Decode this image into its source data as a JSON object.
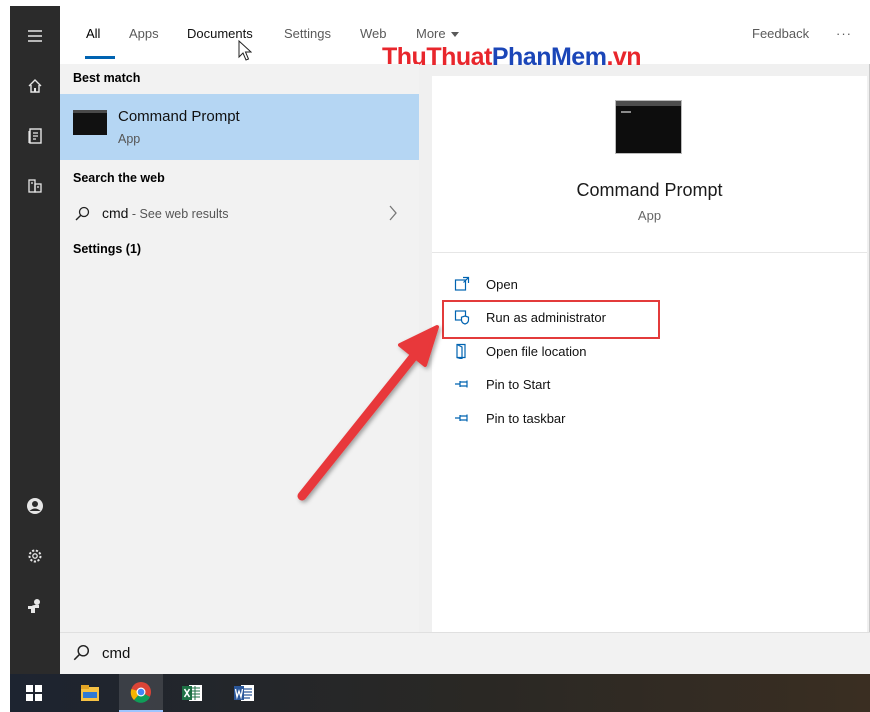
{
  "tabs": {
    "items": [
      "All",
      "Apps",
      "Documents",
      "Settings",
      "Web",
      "More"
    ],
    "feedback": "Feedback",
    "overflow": "···"
  },
  "watermark": {
    "part1": "ThuThuat",
    "part2": "PhanMem",
    "part3": ".vn"
  },
  "results": {
    "best_match_heading": "Best match",
    "best_match": {
      "title": "Command Prompt",
      "subtitle": "App"
    },
    "web_heading": "Search the web",
    "web_query": "cmd",
    "web_hint": " - See web results",
    "settings_heading": "Settings (1)"
  },
  "preview": {
    "title": "Command Prompt",
    "subtitle": "App",
    "actions": [
      "Open",
      "Run as administrator",
      "Open file location",
      "Pin to Start",
      "Pin to taskbar"
    ]
  },
  "search": {
    "value": "cmd"
  },
  "colors": {
    "accent": "#0063b1",
    "selection": "#b5d6f3",
    "annotation": "#e33b3b"
  },
  "icons": {
    "rail": [
      "hamburger-menu-icon",
      "home-icon",
      "documents-icon",
      "apps-icon",
      "user-icon",
      "settings-gear-icon",
      "power-person-icon"
    ],
    "taskbar": [
      "windows-start-icon",
      "file-explorer-icon",
      "chrome-icon",
      "excel-icon",
      "word-icon"
    ]
  }
}
